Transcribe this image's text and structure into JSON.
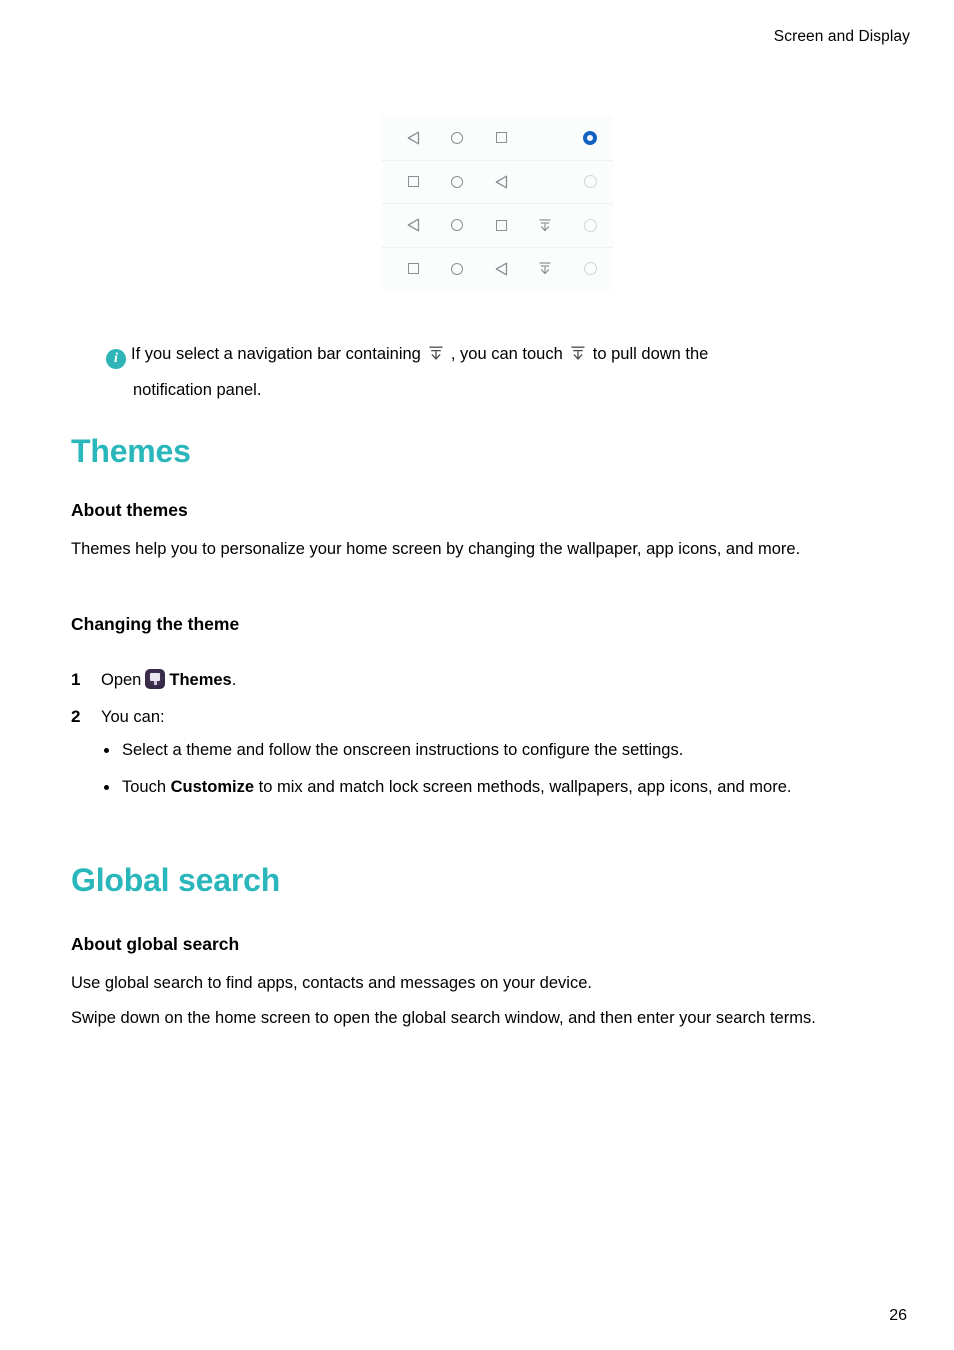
{
  "header": {
    "running_title": "Screen and Display"
  },
  "figure": {
    "name": "navigation-bar-layout-options",
    "selected_index": 0,
    "selected_color": "#1262c4",
    "rows": [
      {
        "icons": [
          "back-triangle",
          "home-circle",
          "recents-square"
        ],
        "selected": true
      },
      {
        "icons": [
          "recents-square",
          "home-circle",
          "back-triangle"
        ],
        "selected": false
      },
      {
        "icons": [
          "back-triangle",
          "home-circle",
          "recents-square",
          "notification-pulldown"
        ],
        "selected": false
      },
      {
        "icons": [
          "recents-square",
          "home-circle",
          "back-triangle",
          "notification-pulldown"
        ],
        "selected": false
      }
    ]
  },
  "note": {
    "icon": "info-icon",
    "icon_color": "#2fb4b8",
    "text_before_first_icon": "If you select a navigation bar containing",
    "text_between_icons": ", you can touch",
    "text_after_second_icon": "to pull down the",
    "second_line": "notification panel."
  },
  "sections": [
    {
      "title": "Themes",
      "title_color": "#2ab7bc",
      "subsections": [
        {
          "heading": "About themes",
          "paragraphs": [
            "Themes help you to personalize your home screen by changing the wallpaper, app icons, and more."
          ]
        },
        {
          "heading": "Changing the theme",
          "steps": [
            {
              "number": "1",
              "text_before_icon": "Open",
              "icon": "themes-app-icon",
              "bold_label": "Themes",
              "text_after": "."
            },
            {
              "number": "2",
              "text_before_icon": "You can:",
              "icon": "",
              "bold_label": "",
              "text_after": ""
            }
          ],
          "bullets": [
            {
              "pre": "Select a theme and follow the onscreen instructions to configure the settings.",
              "bold": "",
              "post": ""
            },
            {
              "pre": "Touch ",
              "bold": "Customize",
              "post": " to mix and match lock screen methods, wallpapers, app icons, and more."
            }
          ]
        }
      ]
    },
    {
      "title": "Global search",
      "title_color": "#2ab7bc",
      "subsections": [
        {
          "heading": "About global search",
          "paragraphs": [
            "Use global search to find apps, contacts and messages on your device.",
            "Swipe down on the home screen to open the global search window, and then enter your search terms."
          ]
        }
      ]
    }
  ],
  "footer": {
    "page_number": "26"
  }
}
